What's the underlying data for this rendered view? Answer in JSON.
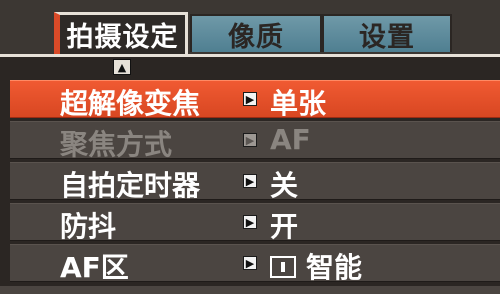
{
  "tabs": {
    "shooting": "拍摄设定",
    "quality": "像质",
    "setup": "设置"
  },
  "menu": [
    {
      "label": "超解像变焦",
      "value": "单张",
      "state": "selected"
    },
    {
      "label": "聚焦方式",
      "value": "AF",
      "state": "disabled"
    },
    {
      "label": "自拍定时器",
      "value": "关",
      "state": "normal"
    },
    {
      "label": "防抖",
      "value": "开",
      "state": "normal"
    },
    {
      "label": "AF区",
      "value": "智能",
      "state": "normal"
    }
  ],
  "icons": {
    "scroll_up": "chevron-up-icon",
    "row_arrow": "chevron-right-icon",
    "af_area": "af-frame-icon"
  },
  "colors": {
    "accent": "#e8532a",
    "tab_inactive": "#5f8b9d",
    "background": "#2b2623",
    "row_bg": "#4b4541",
    "text": "#ffffff",
    "disabled_text": "#8a8580"
  }
}
